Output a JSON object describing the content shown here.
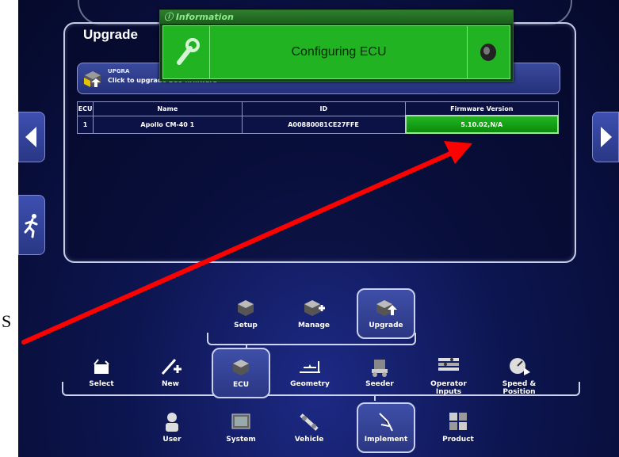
{
  "panel": {
    "title": "Upgrade",
    "bar_title": "UPGRA",
    "bar_subtitle": "Click to upgrade ECU firmware"
  },
  "table": {
    "headers": [
      "ECU",
      "Name",
      "ID",
      "Firmware Version"
    ],
    "rows": [
      {
        "ecu": "1",
        "name": "Apollo CM-40 1",
        "id": "A00880081CE27FFE",
        "firmware": "5.10.02,N/A"
      }
    ]
  },
  "info_popup": {
    "header": "Information",
    "message": "Configuring ECU",
    "icons": [
      "info-icon",
      "wrench-icon",
      "speaker-icon"
    ]
  },
  "top_menu": [
    {
      "label": "Setup",
      "icon": "setup-icon"
    },
    {
      "label": "Manage",
      "icon": "manage-icon"
    },
    {
      "label": "Upgrade",
      "icon": "upgrade-icon",
      "active": true
    }
  ],
  "mid_menu": [
    {
      "label": "Select",
      "icon": "select-icon"
    },
    {
      "label": "New",
      "icon": "new-icon"
    },
    {
      "label": "ECU",
      "icon": "ecu-icon",
      "active": true
    },
    {
      "label": "Geometry",
      "icon": "geometry-icon"
    },
    {
      "label": "Seeder",
      "icon": "seeder-icon"
    },
    {
      "label": "Operator Inputs",
      "icon": "operator-inputs-icon"
    },
    {
      "label": "Speed & Position",
      "icon": "speed-position-icon"
    }
  ],
  "bottom_menu": [
    {
      "label": "User",
      "icon": "user-icon"
    },
    {
      "label": "System",
      "icon": "system-icon"
    },
    {
      "label": "Vehicle",
      "icon": "vehicle-icon"
    },
    {
      "label": "Implement",
      "icon": "implement-icon",
      "active": true
    },
    {
      "label": "Product",
      "icon": "product-icon"
    }
  ],
  "side_nav": {
    "left": "arrow-left-icon",
    "right": "arrow-right-icon",
    "run": "running-man-icon"
  },
  "annotation": {
    "fragment": "S",
    "arrow_color": "#ff0000"
  },
  "colors": {
    "highlight_green": "#1aa81a",
    "panel_blue": "#2a3785",
    "background": "#0d1550"
  }
}
